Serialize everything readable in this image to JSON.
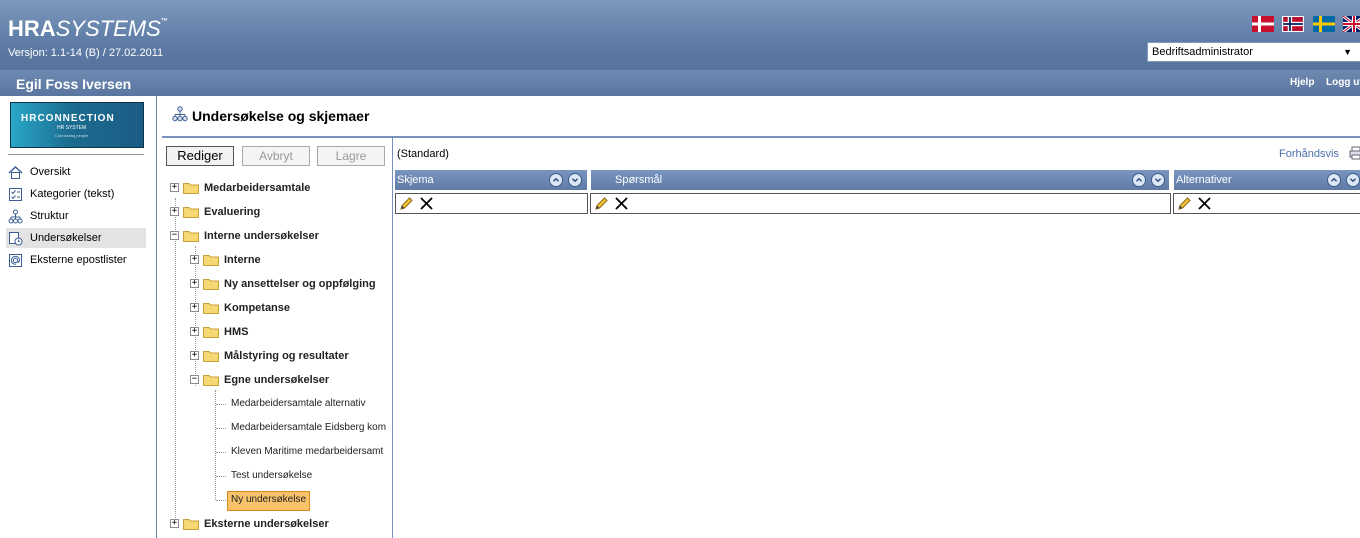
{
  "header": {
    "logo_bold": "HRA",
    "logo_italic": "SYSTEMS",
    "logo_tm": "™",
    "version": "Versjon: 1.1-14 (B) / 27.02.2011",
    "role_selected": "Bedriftsadministrator",
    "languages": [
      "danish-flag-icon",
      "norwegian-flag-icon",
      "swedish-flag-icon",
      "english-flag-icon"
    ]
  },
  "userbar": {
    "user_name": "Egil Foss Iversen",
    "help": "Hjelp",
    "logout": "Logg ut"
  },
  "banner": {
    "title": "HRCONNECTION",
    "subtitle": "HR SYSTEM",
    "tagline": "Connecting people"
  },
  "nav": {
    "items": [
      {
        "label": "Oversikt",
        "icon": "home-icon"
      },
      {
        "label": "Kategorier (tekst)",
        "icon": "checklist-icon"
      },
      {
        "label": "Struktur",
        "icon": "org-structure-icon"
      },
      {
        "label": "Undersøkelser",
        "icon": "survey-icon",
        "selected": true
      },
      {
        "label": "Eksterne epostlister",
        "icon": "email-list-icon"
      }
    ]
  },
  "main": {
    "title": "Undersøkelse og skjemaer",
    "buttons": {
      "edit": "Rediger",
      "cancel": "Avbryt",
      "save": "Lagre"
    },
    "tree": {
      "nodes": [
        {
          "label": "Medarbeidersamtale",
          "expanded": false
        },
        {
          "label": "Evaluering",
          "expanded": false
        },
        {
          "label": "Interne undersøkelser",
          "expanded": true,
          "children": [
            {
              "label": "Interne",
              "expanded": false
            },
            {
              "label": "Ny ansettelser og oppfølging",
              "expanded": false
            },
            {
              "label": "Kompetanse",
              "expanded": false
            },
            {
              "label": "HMS",
              "expanded": false
            },
            {
              "label": "Målstyring og resultater",
              "expanded": false
            },
            {
              "label": "Egne undersøkelser",
              "expanded": true,
              "children": [
                {
                  "label": "Medarbeidersamtale alternativ"
                },
                {
                  "label": "Medarbeidersamtale Eidsberg kom"
                },
                {
                  "label": "Kleven Maritime medarbeidersamt"
                },
                {
                  "label": "Test undersøkelse"
                },
                {
                  "label": "Ny undersøkelse",
                  "selected": true
                }
              ]
            }
          ]
        },
        {
          "label": "Eksterne undersøkelser",
          "expanded": false
        }
      ]
    },
    "content": {
      "standard_label": "(Standard)",
      "preview_link": "Forhåndsvis",
      "columns": [
        {
          "label": "Skjema"
        },
        {
          "label": "Spørsmål"
        },
        {
          "label": "Alternativer"
        }
      ]
    }
  }
}
